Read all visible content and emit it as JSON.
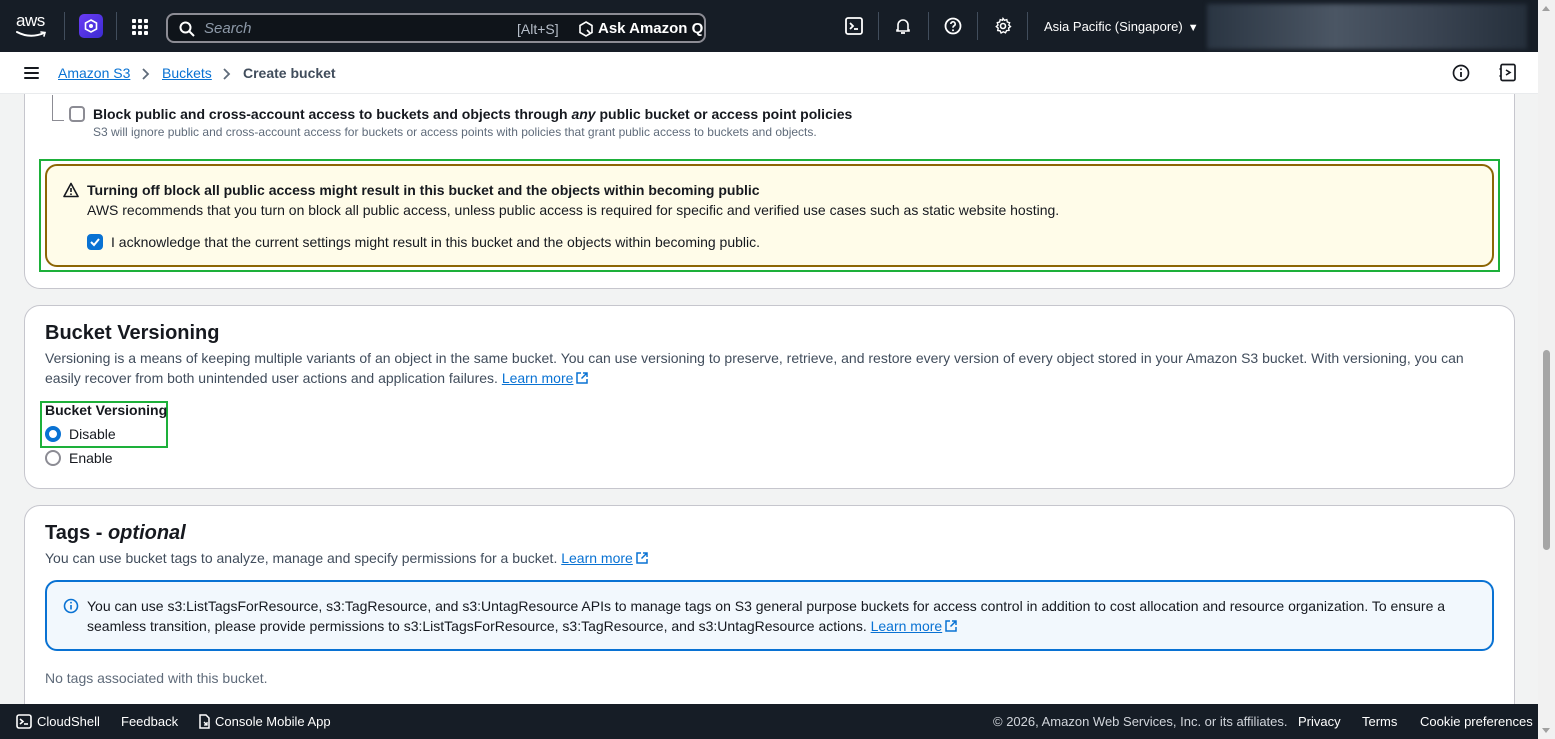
{
  "topnav": {
    "logo_text": "aws",
    "search_placeholder": "Search",
    "search_shortcut": "[Alt+S]",
    "ask_q_label": "Ask Amazon Q",
    "region": "Asia Pacific (Singapore)"
  },
  "breadcrumb": {
    "items": [
      "Amazon S3",
      "Buckets",
      "Create bucket"
    ]
  },
  "block_access": {
    "option_title_pre": "Block public and cross-account access to buckets and objects through ",
    "option_title_em": "any",
    "option_title_post": " public bucket or access point policies",
    "option_desc": "S3 will ignore public and cross-account access for buckets or access points with policies that grant public access to buckets and objects.",
    "warning_title": "Turning off block all public access might result in this bucket and the objects within becoming public",
    "warning_body": "AWS recommends that you turn on block all public access, unless public access is required for specific and verified use cases such as static website hosting.",
    "ack_label": "I acknowledge that the current settings might result in this bucket and the objects within becoming public."
  },
  "versioning": {
    "title": "Bucket Versioning",
    "description_line1": "Versioning is a means of keeping multiple variants of an object in the same bucket. You can use versioning to preserve, retrieve, and restore every version of every object stored in your Amazon S3 bucket. With versioning, you can",
    "description_line2": "easily recover from both unintended user actions and application failures.",
    "learn_more": "Learn more",
    "field_label": "Bucket Versioning",
    "options": [
      "Disable",
      "Enable"
    ],
    "selected": "Disable"
  },
  "tags": {
    "title_main": "Tags - ",
    "title_optional": "optional",
    "description": "You can use bucket tags to analyze, manage and specify permissions for a bucket.",
    "learn_more": "Learn more",
    "info_line1": "You can use s3:ListTagsForResource, s3:TagResource, and s3:UntagResource APIs to manage tags on S3 general purpose buckets for access control in addition to cost allocation and resource organization. To ensure a",
    "info_line2": "seamless transition, please provide permissions to s3:ListTagsForResource, s3:TagResource, and s3:UntagResource actions.",
    "info_learn_more": "Learn more",
    "empty_text": "No tags associated with this bucket."
  },
  "footer": {
    "cloudshell": "CloudShell",
    "feedback": "Feedback",
    "mobile_app": "Console Mobile App",
    "copyright": "© 2026, Amazon Web Services, Inc. or its affiliates.",
    "privacy": "Privacy",
    "terms": "Terms",
    "cookies": "Cookie preferences"
  },
  "colors": {
    "nav_bg": "#161d26",
    "link": "#0972d3",
    "highlight": "#1db03a",
    "warning_border": "#8d6605",
    "warning_bg": "#fffce9"
  }
}
